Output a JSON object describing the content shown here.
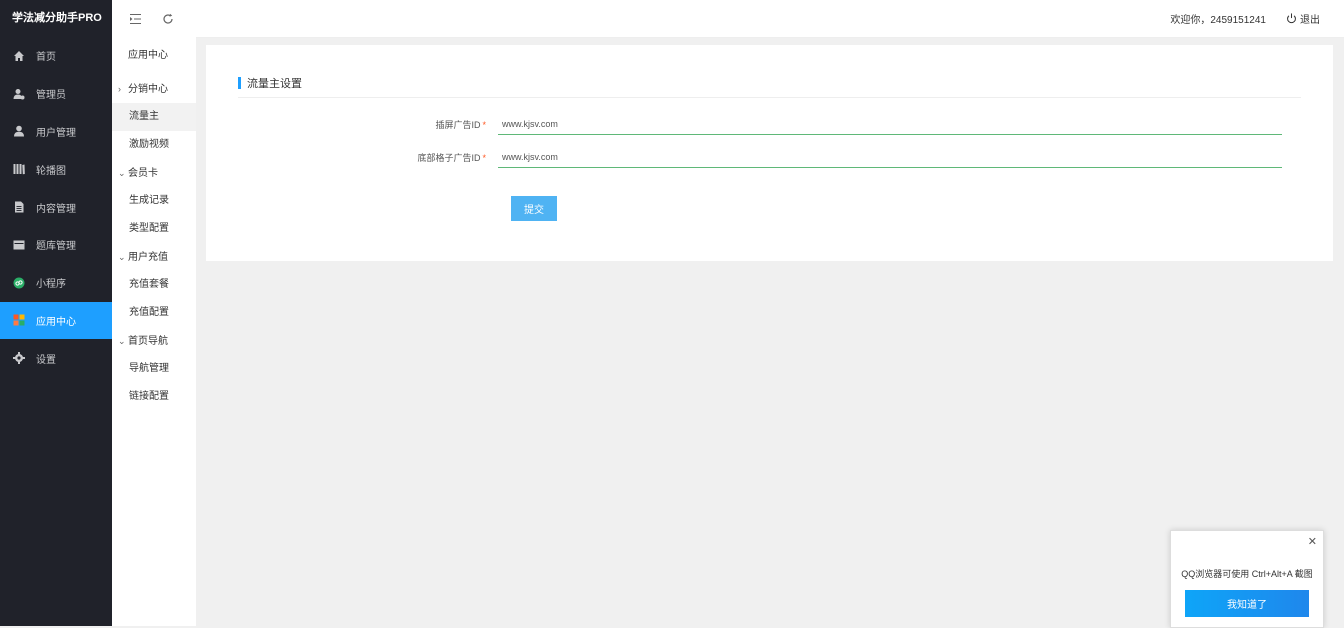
{
  "app": {
    "brand": "学法减分助手PRO"
  },
  "sidebar": {
    "items": [
      {
        "label": "首页",
        "icon": "home-icon"
      },
      {
        "label": "管理员",
        "icon": "admin-icon"
      },
      {
        "label": "用户管理",
        "icon": "user-icon"
      },
      {
        "label": "轮播图",
        "icon": "carousel-icon"
      },
      {
        "label": "内容管理",
        "icon": "document-icon"
      },
      {
        "label": "题库管理",
        "icon": "question-bank-icon"
      },
      {
        "label": "小程序",
        "icon": "miniprogram-icon"
      },
      {
        "label": "应用中心",
        "icon": "app-center-icon",
        "active": true
      },
      {
        "label": "设置",
        "icon": "gear-icon"
      }
    ]
  },
  "subnav": {
    "title": "应用中心",
    "groups": [
      {
        "label": "分销中心",
        "expanded": false
      },
      {
        "label": "流量主",
        "active": true
      },
      {
        "label": "激励视频"
      },
      {
        "label": "会员卡",
        "expanded": true
      },
      {
        "label": "生成记录"
      },
      {
        "label": "类型配置"
      },
      {
        "label": "用户充值",
        "expanded": true
      },
      {
        "label": "充值套餐"
      },
      {
        "label": "充值配置"
      },
      {
        "label": "首页导航",
        "expanded": true
      },
      {
        "label": "导航管理"
      },
      {
        "label": "链接配置"
      }
    ]
  },
  "topbar": {
    "welcome": "欢迎你，2459151241",
    "logout": "退出"
  },
  "form": {
    "title": "流量主设置",
    "fields": [
      {
        "label": "插屏广告ID",
        "value": "www.kjsv.com"
      },
      {
        "label": "底部格子广告ID",
        "value": "www.kjsv.com"
      }
    ],
    "submit": "提交"
  },
  "popup": {
    "message": "QQ浏览器可使用 Ctrl+Alt+A 截图",
    "button": "我知道了"
  },
  "colors": {
    "accent": "#1e9fff",
    "sidebar_bg": "#20222a",
    "input_border": "#5fb878",
    "required": "#ff5722"
  }
}
